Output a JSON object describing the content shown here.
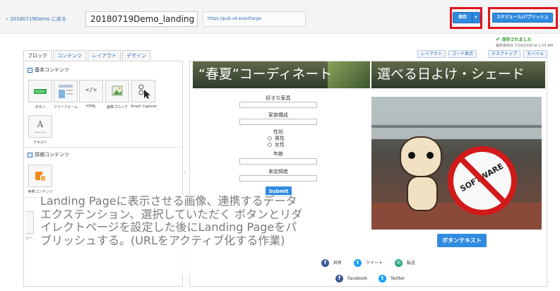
{
  "header": {
    "back_link": "20180719Demo に戻る",
    "title_value": "20180719Demo_landing",
    "url_value": "https://pub.s4.exacttarge",
    "save_label": "保存",
    "schedule_label": "スケジュール/パブリッシュ",
    "saved_status": "保存されました",
    "last_saved": "最終保存日 7/19/2018 at 1:55 AM"
  },
  "left_panel": {
    "tabs": [
      {
        "label": "ブロック",
        "active": true
      },
      {
        "label": "コンテンツ",
        "active": false
      },
      {
        "label": "レイアウト",
        "active": false
      },
      {
        "label": "デザイン",
        "active": false
      }
    ],
    "basic_section": "基本コンテンツ",
    "basic_blocks": [
      "ボタン",
      "フリーフォーム",
      "HTML",
      "画像ブロック",
      "Smart Capture",
      "テキスト"
    ],
    "advanced_section": "詳細コンテンツ",
    "advanced_blocks": [
      "参照コンテンツ"
    ],
    "thumb_button_text": "Button",
    "thumb_html_text": "</>",
    "thumb_text_text": "A",
    "partial_label": "ソー"
  },
  "right_toolbar": {
    "layout_label": "レイアウト",
    "code_view_label": "コード表示",
    "desktop_label": "デスクトップ",
    "mobile_label": "モバイル"
  },
  "canvas": {
    "hero_left": "“春夏”コーディネート",
    "hero_right": "選べる日よけ・シェード",
    "form_fields": [
      {
        "label": "好きな家具"
      },
      {
        "label": "家族構成"
      },
      {
        "label": "性別"
      },
      {
        "label": "年齢"
      },
      {
        "label": "来店頻度"
      }
    ],
    "radio_options": [
      "男性",
      "女性"
    ],
    "submit_label": "Submit",
    "cta_label": "ボタンテキスト",
    "photo_sign": "SOFTWARE",
    "social": [
      {
        "icon": "facebook-icon",
        "glyph": "f",
        "label": "共有",
        "color": "#3b5998"
      },
      {
        "icon": "twitter-icon",
        "glyph": "t",
        "label": "ツイート",
        "color": "#1da1f2"
      },
      {
        "icon": "mail-icon",
        "glyph": "✉",
        "label": "転送",
        "color": "#2aa884"
      },
      {
        "icon": "facebook-icon",
        "glyph": "f",
        "label": "Facebook",
        "color": "#3b5998"
      },
      {
        "icon": "twitter-icon",
        "glyph": "t",
        "label": "Twitter",
        "color": "#1da1f2"
      }
    ]
  },
  "overlay": {
    "caption": "Landing Pageに表示させる画像、連携するデータエクステンション、選択していただく ボタンとリダイレクトページを設定した後にLanding Pageをパブリッシュする。(URLをアクティブ化する作業)"
  },
  "colors": {
    "accent_blue": "#2f8be0",
    "highlight_red": "#e0141b",
    "saved_green": "#2e9a2e",
    "link_blue": "#2a6bb3"
  }
}
